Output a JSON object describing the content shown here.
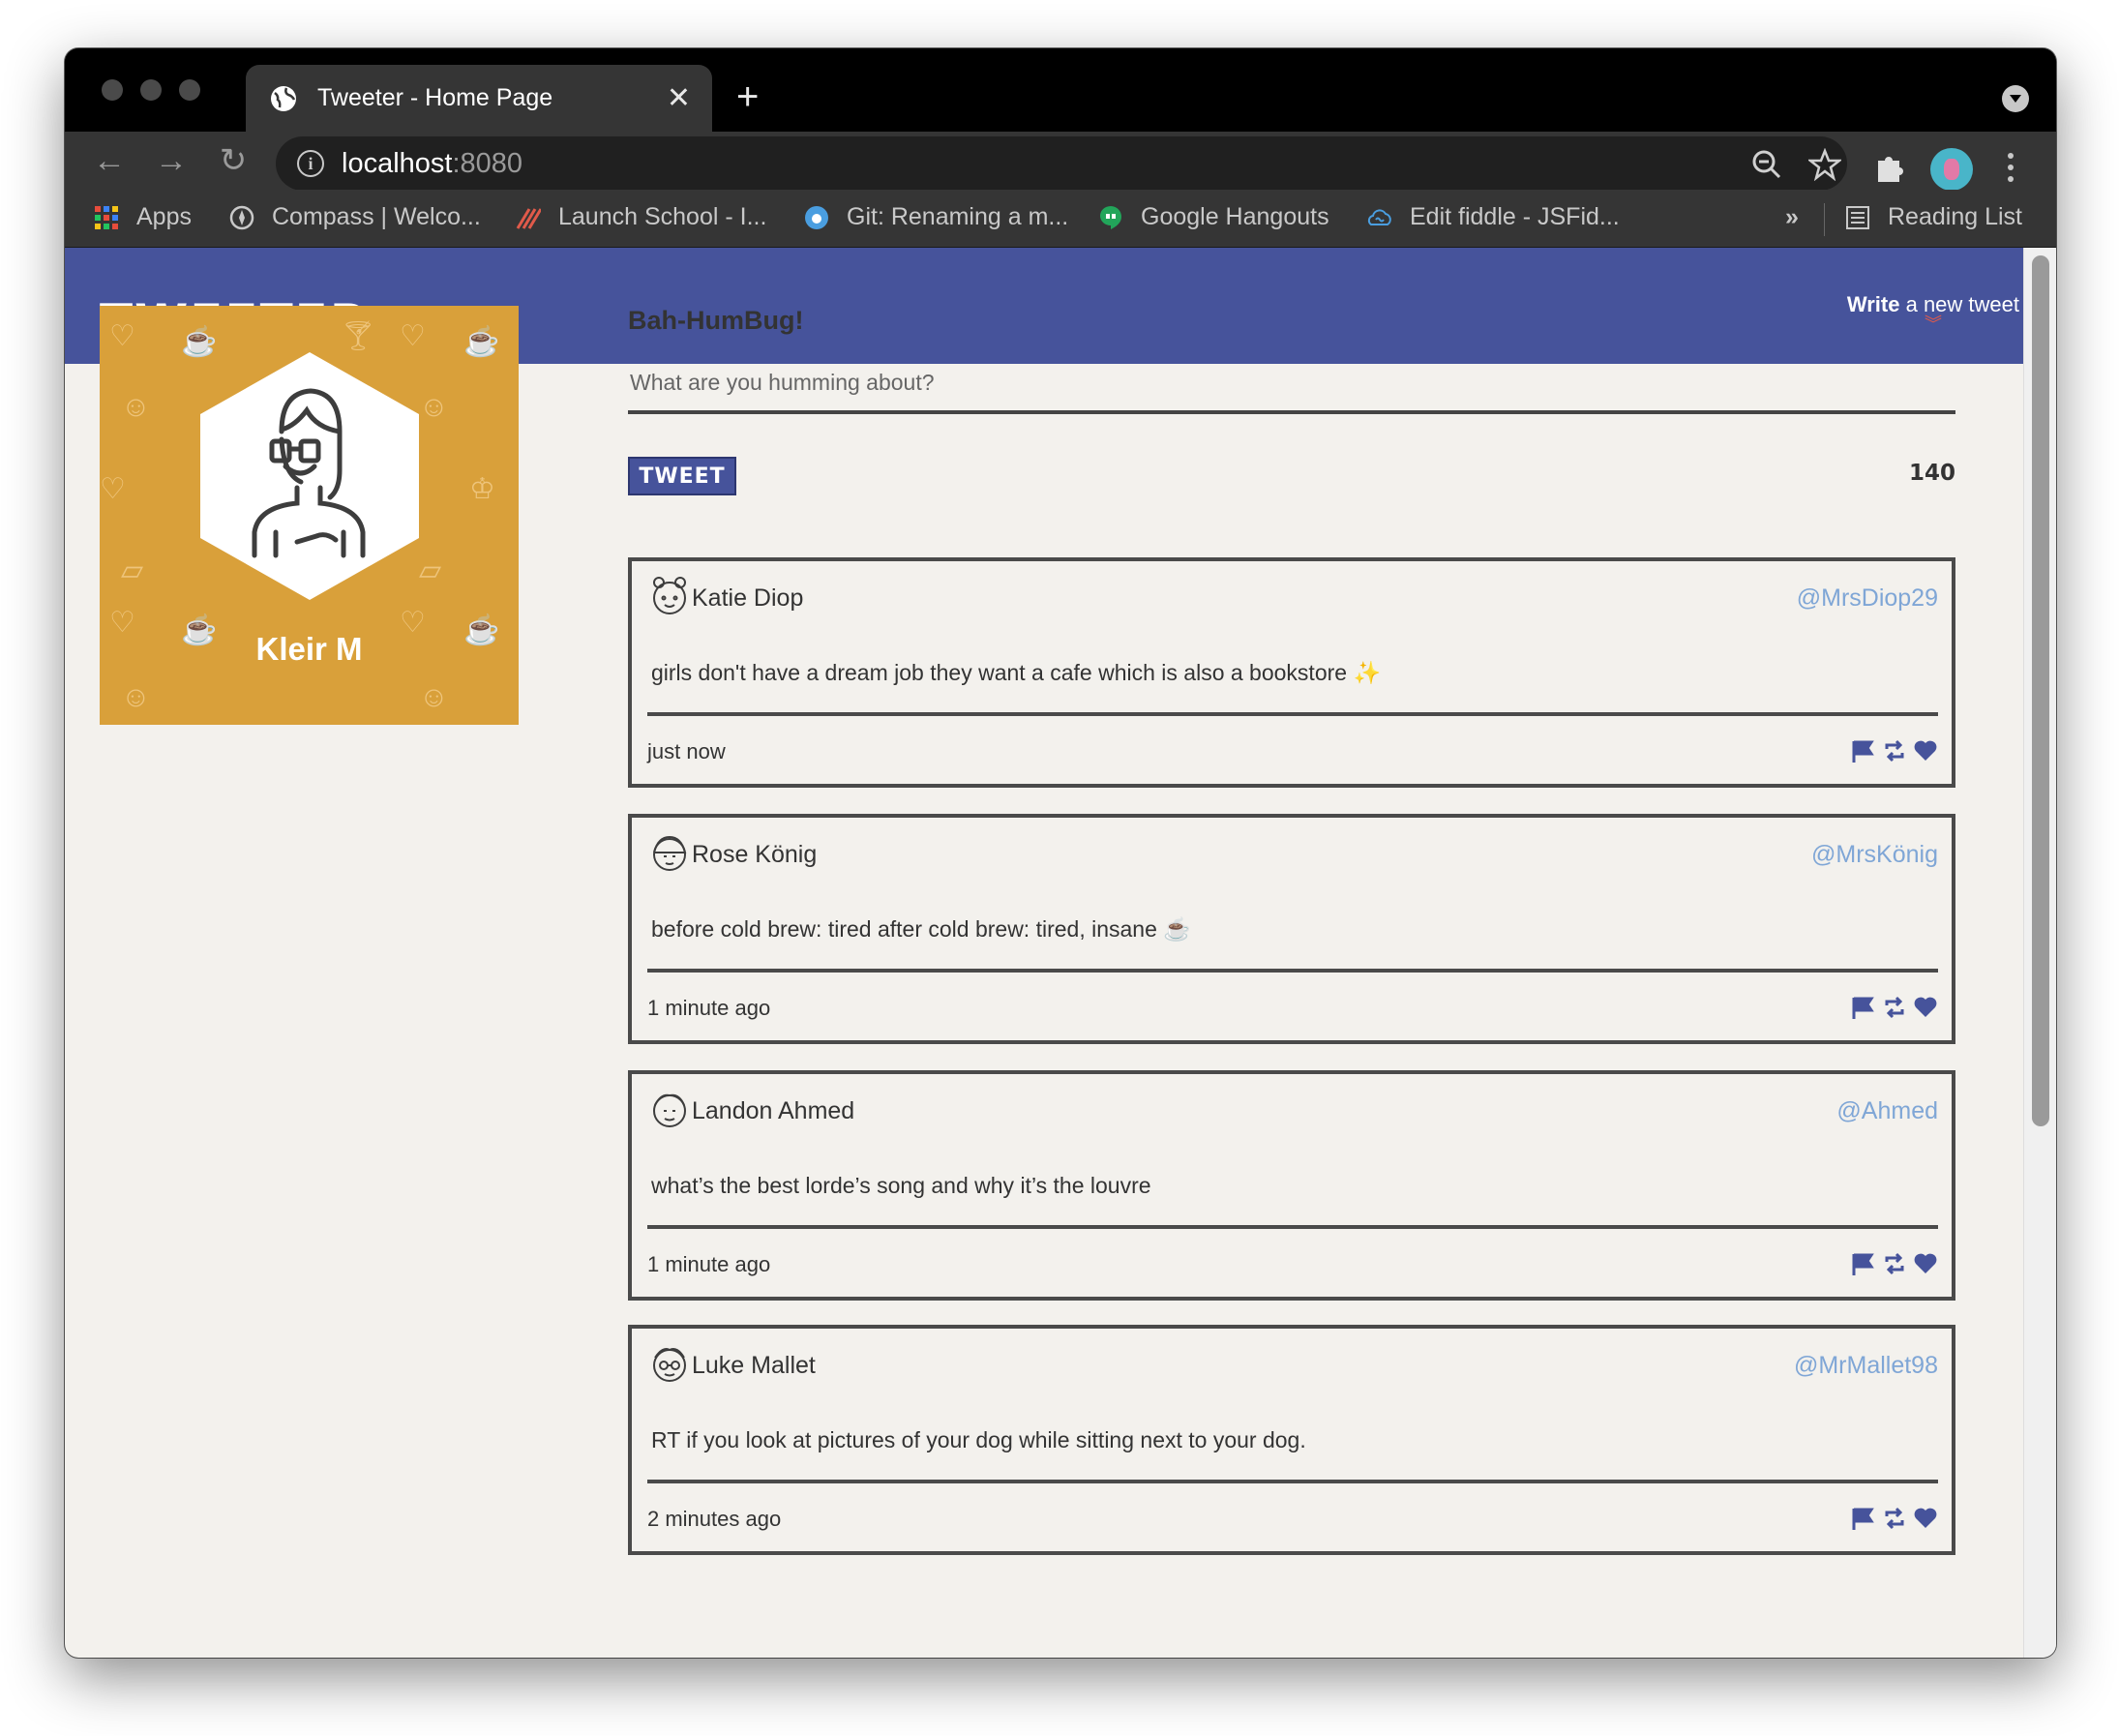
{
  "browser": {
    "tab_title": "Tweeter - Home Page",
    "url_host": "localhost",
    "url_port": ":8080",
    "bookmarks": [
      {
        "label": "Apps",
        "icon": "apps-grid-icon"
      },
      {
        "label": "Compass | Welco...",
        "icon": "compass-icon"
      },
      {
        "label": "Launch School - I...",
        "icon": "launch-school-icon"
      },
      {
        "label": "Git: Renaming a m...",
        "icon": "git-icon"
      },
      {
        "label": "Google Hangouts",
        "icon": "hangouts-icon"
      },
      {
        "label": "Edit fiddle - JSFid...",
        "icon": "jsfiddle-icon"
      }
    ],
    "overflow_label": "»",
    "reading_list": "Reading List"
  },
  "nav": {
    "brand": "TWEETER",
    "compose_bold": "Write",
    "compose_rest": " a new tweet",
    "compose_chevron": "»"
  },
  "profile": {
    "name": "Kleir M"
  },
  "composer": {
    "heading": "Bah-HumBug!",
    "placeholder": "What are you humming about?",
    "button": "TWEET",
    "counter": "140"
  },
  "tweets": [
    {
      "name": "Katie Diop",
      "handle": "@MrsDiop29",
      "text": "girls don't have a dream job they want a cafe which is also a bookstore ✨",
      "time": "just now"
    },
    {
      "name": "Rose König",
      "handle": "@MrsKönig",
      "text": "before cold brew: tired after cold brew: tired, insane ☕",
      "time": "1 minute ago"
    },
    {
      "name": "Landon Ahmed",
      "handle": "@Ahmed",
      "text": "what’s the best lorde’s song and why it’s the louvre",
      "time": "1 minute ago"
    },
    {
      "name": "Luke Mallet",
      "handle": "@MrMallet98",
      "text": "RT if you look at pictures of your dog while sitting next to your dog.",
      "time": "2 minutes ago"
    }
  ],
  "colors": {
    "nav": "#46539b",
    "page_bg": "#f3f1ed",
    "profile_bg": "#d9a03a",
    "handle": "#7fa6d6",
    "action_icons": "#46539b"
  }
}
